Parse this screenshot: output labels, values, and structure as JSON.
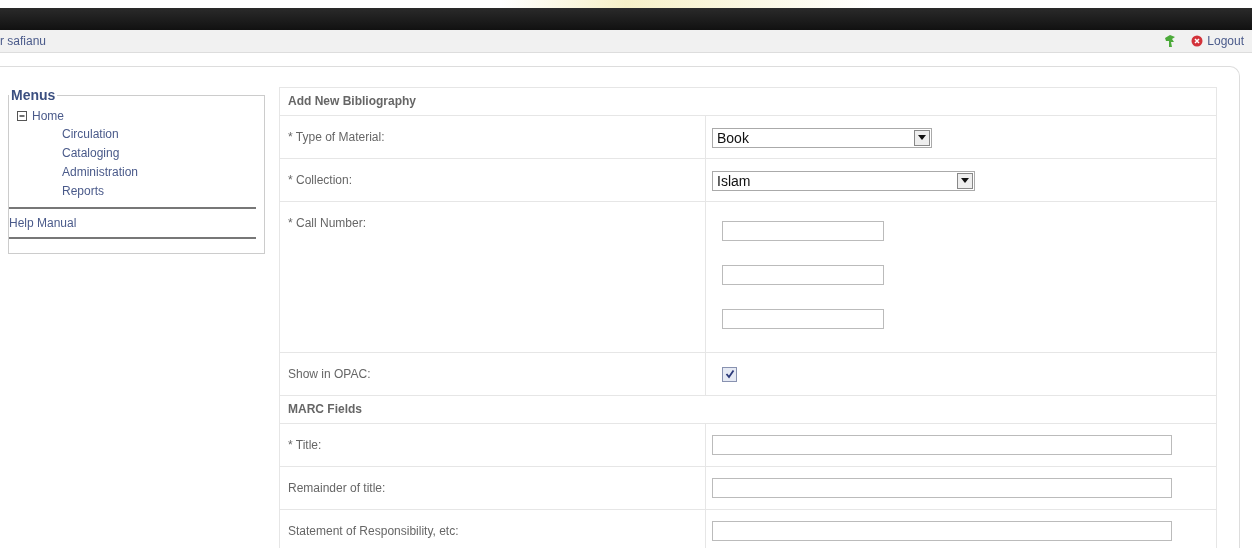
{
  "header": {
    "user": "r safianu",
    "logout": "Logout"
  },
  "menu": {
    "title": "Menus",
    "items": [
      {
        "label": "Home",
        "expanded": true,
        "children": [
          {
            "label": "Circulation"
          },
          {
            "label": "Cataloging"
          },
          {
            "label": "Administration"
          },
          {
            "label": "Reports"
          }
        ]
      }
    ],
    "links": [
      "Help Manual"
    ]
  },
  "form": {
    "rows": [
      {
        "kind": "section",
        "label": "Add New Bibliography"
      },
      {
        "kind": "select",
        "label": "* Type of Material:",
        "value": "Book"
      },
      {
        "kind": "select",
        "label": "* Collection:",
        "value": "Islam"
      },
      {
        "kind": "multi",
        "label": "* Call Number:"
      },
      {
        "kind": "checkbox",
        "label": "Show in OPAC:",
        "checked": true
      },
      {
        "kind": "section",
        "label": "MARC Fields"
      },
      {
        "kind": "text",
        "label": "* Title:"
      },
      {
        "kind": "text",
        "label": "Remainder of title:"
      },
      {
        "kind": "text",
        "label": "Statement of Responsibility, etc:"
      }
    ]
  }
}
